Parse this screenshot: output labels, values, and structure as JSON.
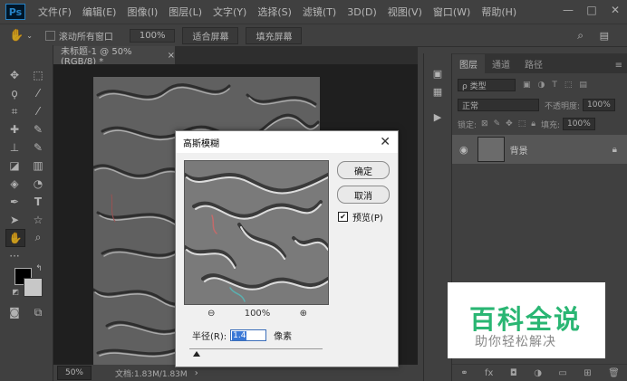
{
  "app": {
    "logo": "Ps",
    "menu": [
      "文件(F)",
      "编辑(E)",
      "图像(I)",
      "图层(L)",
      "文字(Y)",
      "选择(S)",
      "滤镜(T)",
      "3D(D)",
      "视图(V)",
      "窗口(W)",
      "帮助(H)"
    ],
    "window_controls": [
      "—",
      "□",
      "✕"
    ]
  },
  "options_bar": {
    "scroll_all_label": "滚动所有窗口",
    "zoom_value": "100%",
    "fit_screen": "适合屏幕",
    "fill_screen": "填充屏幕"
  },
  "document": {
    "tab_title": "未标题-1 @ 50%(RGB/8) *",
    "tab_close": "×",
    "status_zoom": "50%",
    "doc_info": "文档:1.83M/1.83M",
    "status_arrow": "›"
  },
  "layers_panel": {
    "tabs": [
      "图层",
      "通道",
      "路径"
    ],
    "filter_kind": "ρ 类型",
    "blend_mode": "正常",
    "opacity_label": "不透明度:",
    "opacity_value": "100%",
    "lock_label": "锁定:",
    "fill_label": "填充:",
    "fill_value": "100%",
    "layer_name": "背景"
  },
  "dialog": {
    "title": "高斯模糊",
    "ok": "确定",
    "cancel": "取消",
    "preview_label": "预览(P)",
    "preview_checked": "✔",
    "zoom_level": "100%",
    "radius_label": "半径(R):",
    "radius_value": "1.4",
    "radius_unit": "像素"
  },
  "watermark": {
    "title": "百科全说",
    "subtitle": "助你轻松解决"
  },
  "colors": {
    "accent_blue": "#31a8ff",
    "watermark_green": "#2ab673"
  }
}
